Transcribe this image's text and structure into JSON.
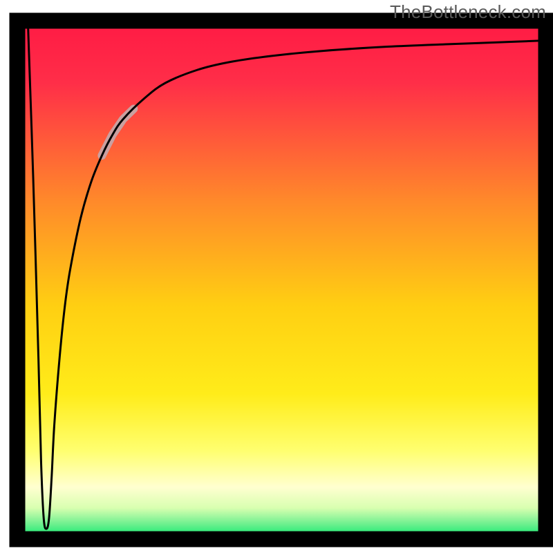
{
  "watermark": "TheBottleneck.com",
  "colors": {
    "gradient_top": "#ff1a44",
    "gradient_mid": "#ffd400",
    "gradient_low": "#ffffc8",
    "gradient_bottom": "#00e869",
    "curve": "#000000",
    "frame": "#000000",
    "highlight": "#caa0a0"
  },
  "chart_data": {
    "type": "line",
    "title": "",
    "xlabel": "",
    "ylabel": "",
    "xlim": [
      0,
      100
    ],
    "ylim": [
      0,
      100
    ],
    "grid": false,
    "legend": false,
    "series": [
      {
        "name": "bottleneck_curve",
        "x": [
          2.0,
          3.0,
          4.0,
          4.5,
          5.0,
          5.5,
          6.0,
          6.5,
          7.0,
          8.0,
          9.0,
          10.0,
          12.0,
          14.0,
          16.0,
          18.0,
          20.0,
          24.0,
          28.0,
          34.0,
          40.0,
          48.0,
          58.0,
          70.0,
          82.0,
          90.0,
          100.0
        ],
        "y": [
          100.0,
          70.0,
          35.0,
          15.0,
          4.0,
          2.0,
          4.0,
          12.0,
          22.0,
          35.0,
          45.0,
          52.0,
          62.0,
          69.0,
          74.0,
          78.0,
          81.0,
          85.0,
          88.0,
          90.5,
          92.0,
          93.2,
          94.2,
          95.0,
          95.5,
          95.8,
          96.2
        ]
      }
    ],
    "highlight_segment": {
      "series": "bottleneck_curve",
      "x_start": 16.0,
      "x_end": 22.0,
      "stroke_width": 12
    },
    "background": "vertical_gradient_red_to_green"
  }
}
